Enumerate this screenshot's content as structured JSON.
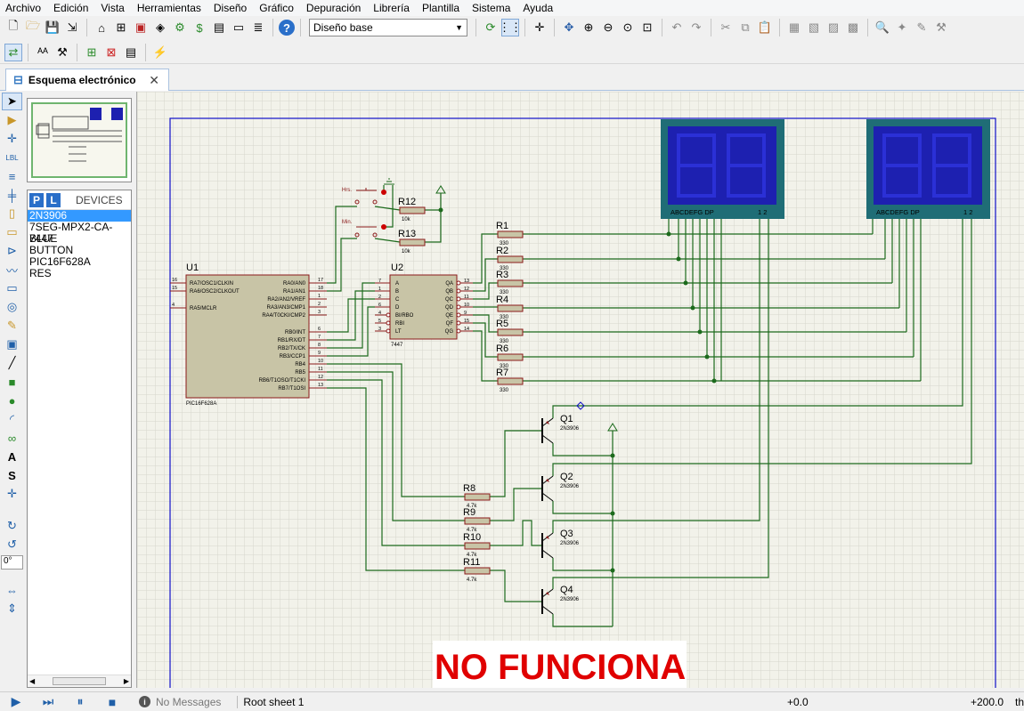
{
  "menu": [
    "Archivo",
    "Edición",
    "Vista",
    "Herramientas",
    "Diseño",
    "Gráfico",
    "Depuración",
    "Librería",
    "Plantilla",
    "Sistema",
    "Ayuda"
  ],
  "toolbar": {
    "layer_select": "Diseño base"
  },
  "tab": {
    "label": "Esquema electrónico"
  },
  "tools": {
    "rotation": "0°"
  },
  "devices": {
    "p_label": "P",
    "l_label": "L",
    "title": "DEVICES",
    "items": [
      "2N3906",
      "7SEG-MPX2-CA-BLUE",
      "7447",
      "BUTTON",
      "PIC16F628A",
      "RES"
    ],
    "selected_index": 0
  },
  "schematic": {
    "u1": {
      "ref": "U1",
      "part": "PIC16F628A",
      "left_pins": [
        [
          "16",
          "RA7/OSC1/CLKIN"
        ],
        [
          "15",
          "RA6/OSC2/CLKOUT"
        ],
        [
          "4",
          "RA5/MCLR"
        ]
      ],
      "right_pins": [
        [
          "RA0/AN0",
          "17"
        ],
        [
          "RA1/AN1",
          "18"
        ],
        [
          "RA2/AN2/VREF",
          "1"
        ],
        [
          "RA3/AN3/CMP1",
          "2"
        ],
        [
          "RA4/T0CKI/CMP2",
          "3"
        ],
        [
          "RB0/INT",
          "6"
        ],
        [
          "RB1/RX/DT",
          "7"
        ],
        [
          "RB2/TX/CK",
          "8"
        ],
        [
          "RB3/CCP1",
          "9"
        ],
        [
          "RB4",
          "10"
        ],
        [
          "RB5",
          "11"
        ],
        [
          "RB6/T1OSO/T1CKI",
          "12"
        ],
        [
          "RB7/T1OSI",
          "13"
        ]
      ]
    },
    "u2": {
      "ref": "U2",
      "part": "7447",
      "left_pins": [
        [
          "7",
          "A"
        ],
        [
          "1",
          "B"
        ],
        [
          "2",
          "C"
        ],
        [
          "6",
          "D"
        ],
        [
          "4",
          "BI/RBO"
        ],
        [
          "5",
          "RBI"
        ],
        [
          "3",
          "LT"
        ]
      ],
      "right_pins": [
        [
          "QA",
          "13"
        ],
        [
          "QB",
          "12"
        ],
        [
          "QC",
          "11"
        ],
        [
          "QD",
          "10"
        ],
        [
          "QE",
          "9"
        ],
        [
          "QF",
          "15"
        ],
        [
          "QG",
          "14"
        ]
      ]
    },
    "buttons": [
      {
        "label": "Hrs."
      },
      {
        "label": "Min."
      }
    ],
    "pullups": [
      {
        "ref": "R12",
        "value": "10k"
      },
      {
        "ref": "R13",
        "value": "10k"
      }
    ],
    "seg_resistors": [
      {
        "ref": "R1",
        "value": "330"
      },
      {
        "ref": "R2",
        "value": "330"
      },
      {
        "ref": "R3",
        "value": "330"
      },
      {
        "ref": "R4",
        "value": "330"
      },
      {
        "ref": "R5",
        "value": "330"
      },
      {
        "ref": "R6",
        "value": "330"
      },
      {
        "ref": "R7",
        "value": "330"
      }
    ],
    "base_resistors": [
      {
        "ref": "R8",
        "value": "4.7k"
      },
      {
        "ref": "R9",
        "value": "4.7k"
      },
      {
        "ref": "R10",
        "value": "4.7k"
      },
      {
        "ref": "R11",
        "value": "4.7k"
      }
    ],
    "transistors": [
      {
        "ref": "Q1",
        "part": "2N3906"
      },
      {
        "ref": "Q2",
        "part": "2N3906"
      },
      {
        "ref": "Q3",
        "part": "2N3906"
      },
      {
        "ref": "Q4",
        "part": "2N3906"
      }
    ],
    "displays": [
      {
        "pins": "ABCDEFG  DP",
        "commons": "1 2"
      },
      {
        "pins": "ABCDEFG  DP",
        "commons": "1 2"
      }
    ],
    "banner": "NO FUNCIONA"
  },
  "status": {
    "messages": "No Messages",
    "sheet": "Root sheet 1",
    "x": "+0.0",
    "y": "+200.0",
    "units": "th"
  },
  "colors": {
    "wire": "#1c6a1c",
    "component_fill": "#c8c4a6",
    "component_stroke": "#8b1a1a",
    "display_frame": "#1f6d76",
    "display_face": "#1d20b0",
    "banner_text": "#e00000",
    "sheet_border": "#1010c8",
    "grid": "#cfcfc6",
    "accent": "#3399ff"
  }
}
